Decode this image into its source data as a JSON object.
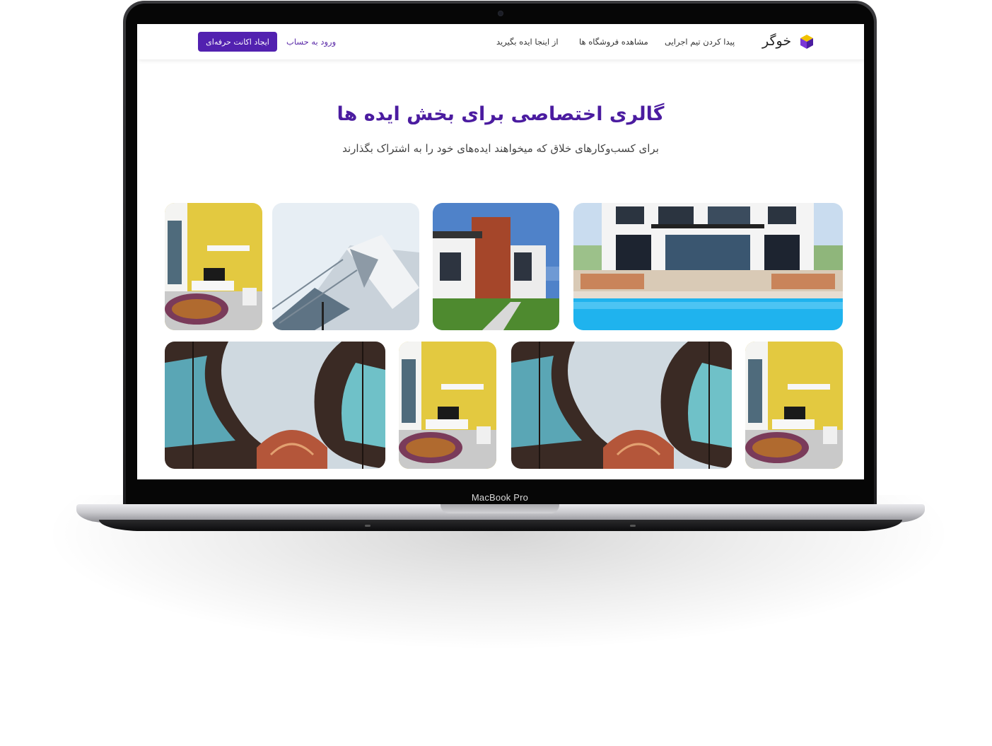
{
  "device": {
    "label": "MacBook Pro"
  },
  "navbar": {
    "logo_text": "خوگر",
    "links": [
      "پیدا کردن تیم اجرایی",
      "مشاهده فروشگاه ها",
      "از اینجا ایده بگیرید"
    ],
    "login_label": "ورود به حساب",
    "cta_label": "ایجاد اکانت حرفه‌ای"
  },
  "hero": {
    "title": "گالری اختصاصی برای بخش ایده ها",
    "subtitle": "برای کسب‌وکارهای خلاق که میخواهند ایده‌های خود را به اشتراک بگذارند"
  },
  "colors": {
    "accent": "#5221b0",
    "title": "#4b1ca0"
  },
  "gallery": {
    "row1": [
      "villa-pool",
      "brick-house",
      "glass-building",
      "living-room"
    ],
    "row2": [
      "living-room",
      "curved-architecture",
      "living-room",
      "curved-architecture"
    ]
  }
}
